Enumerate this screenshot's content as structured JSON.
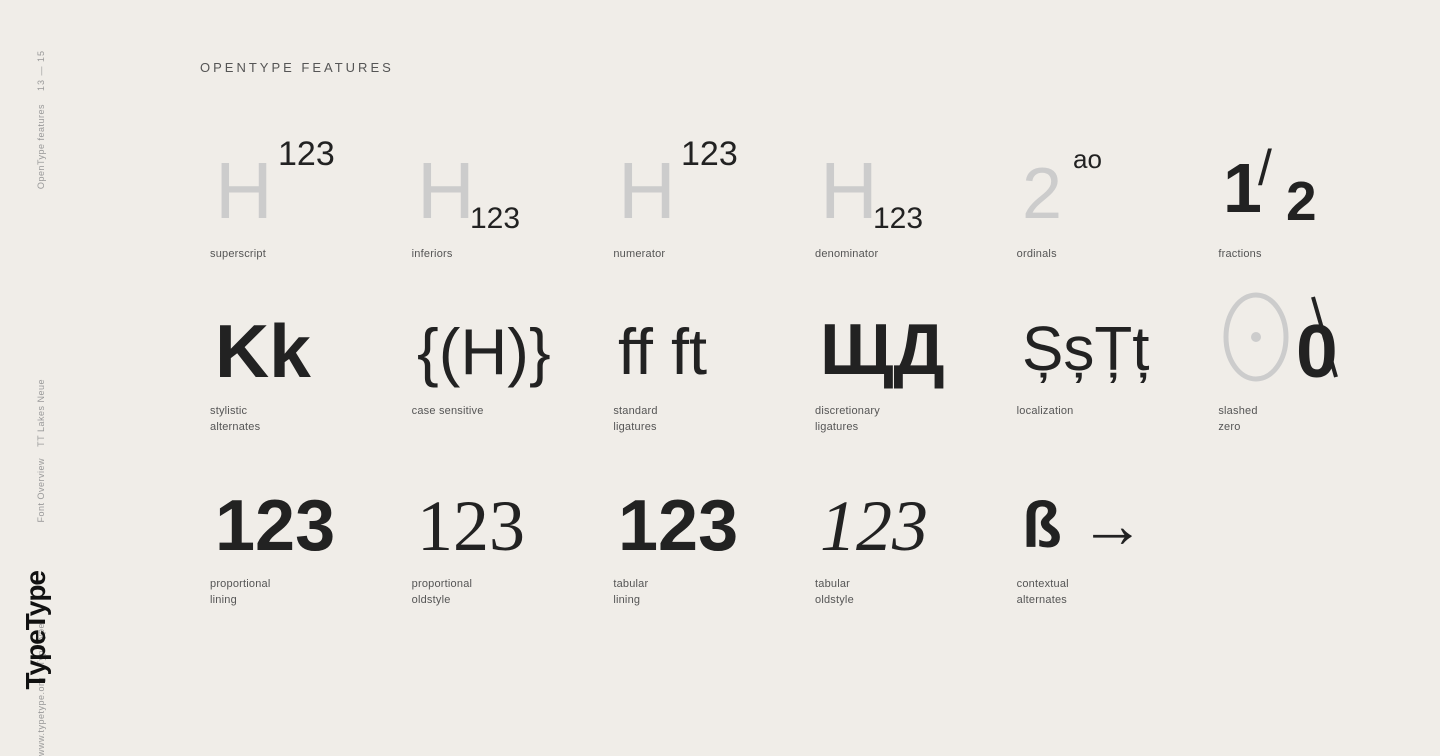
{
  "sidebar": {
    "page_range": "13 — 15",
    "section": "OpenType features",
    "font_name": "TT Lakes Neue",
    "font_subtitle": "Font Overview",
    "brand": "TypeType",
    "url": "www.typetype.org"
  },
  "header": {
    "title": "OPENTYPE FEATURES"
  },
  "features": [
    {
      "id": "superscript",
      "glyph_type": "superscript",
      "label_line1": "superscript",
      "label_line2": ""
    },
    {
      "id": "inferiors",
      "glyph_type": "inferiors",
      "label_line1": "inferiors",
      "label_line2": ""
    },
    {
      "id": "numerator",
      "glyph_type": "numerator",
      "label_line1": "numerator",
      "label_line2": ""
    },
    {
      "id": "denominator",
      "glyph_type": "denominator",
      "label_line1": "denominator",
      "label_line2": ""
    },
    {
      "id": "ordinals",
      "glyph_type": "ordinals",
      "label_line1": "ordinals",
      "label_line2": ""
    },
    {
      "id": "fractions",
      "glyph_type": "fractions",
      "label_line1": "fractions",
      "label_line2": ""
    },
    {
      "id": "stylistic-alternates",
      "glyph_type": "stylistic",
      "label_line1": "stylistic",
      "label_line2": "alternates"
    },
    {
      "id": "case-sensitive",
      "glyph_type": "case",
      "label_line1": "case sensitive",
      "label_line2": ""
    },
    {
      "id": "standard-ligatures",
      "glyph_type": "standard-lig",
      "label_line1": "standard",
      "label_line2": "ligatures"
    },
    {
      "id": "discretionary-ligatures",
      "glyph_type": "discretionary",
      "label_line1": "discretionary",
      "label_line2": "ligatures"
    },
    {
      "id": "localization",
      "glyph_type": "localization",
      "label_line1": "localization",
      "label_line2": ""
    },
    {
      "id": "slashed-zero",
      "glyph_type": "slashed-zero",
      "label_line1": "slashed",
      "label_line2": "zero"
    },
    {
      "id": "proportional-lining",
      "glyph_type": "prop-lining",
      "label_line1": "proportional",
      "label_line2": "lining"
    },
    {
      "id": "proportional-oldstyle",
      "glyph_type": "prop-oldstyle",
      "label_line1": "proportional",
      "label_line2": "oldstyle"
    },
    {
      "id": "tabular-lining",
      "glyph_type": "tab-lining",
      "label_line1": "tabular",
      "label_line2": "lining"
    },
    {
      "id": "tabular-oldstyle",
      "glyph_type": "tab-oldstyle",
      "label_line1": "tabular",
      "label_line2": "oldstyle"
    },
    {
      "id": "contextual-alternates",
      "glyph_type": "contextual",
      "label_line1": "contextual",
      "label_line2": "alternates"
    }
  ]
}
